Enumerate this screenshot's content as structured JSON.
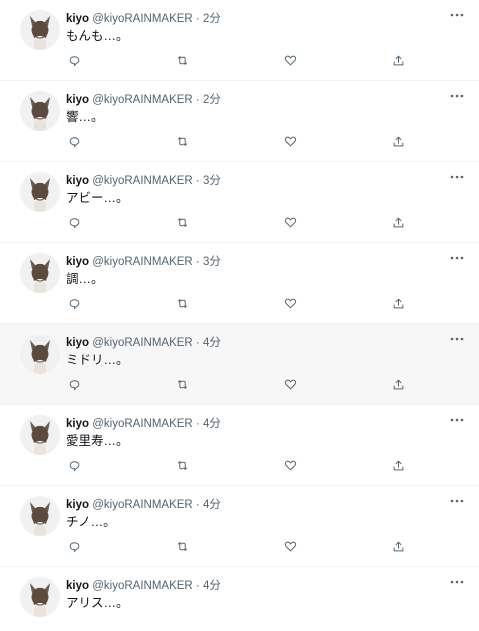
{
  "tweets": [
    {
      "name": "kiyo",
      "handle": "@kiyoRAINMAKER",
      "time": "· 2分",
      "text": "もんも…。"
    },
    {
      "name": "kiyo",
      "handle": "@kiyoRAINMAKER",
      "time": "· 2分",
      "text": "響…。"
    },
    {
      "name": "kiyo",
      "handle": "@kiyoRAINMAKER",
      "time": "· 3分",
      "text": "アビー…。"
    },
    {
      "name": "kiyo",
      "handle": "@kiyoRAINMAKER",
      "time": "· 3分",
      "text": "調…。"
    },
    {
      "name": "kiyo",
      "handle": "@kiyoRAINMAKER",
      "time": "· 4分",
      "text": "ミドリ…。"
    },
    {
      "name": "kiyo",
      "handle": "@kiyoRAINMAKER",
      "time": "· 4分",
      "text": "愛里寿…。"
    },
    {
      "name": "kiyo",
      "handle": "@kiyoRAINMAKER",
      "time": "· 4分",
      "text": "チノ…。"
    },
    {
      "name": "kiyo",
      "handle": "@kiyoRAINMAKER",
      "time": "· 4分",
      "text": "アリス…。"
    }
  ],
  "icons": {
    "more": "more-icon",
    "reply": "reply-icon",
    "retweet": "retweet-icon",
    "like": "like-icon",
    "share": "share-icon"
  },
  "colors": {
    "text": "#0f1419",
    "secondary": "#536471",
    "divider": "#eff3f4",
    "hover": "#f7f7f7"
  }
}
